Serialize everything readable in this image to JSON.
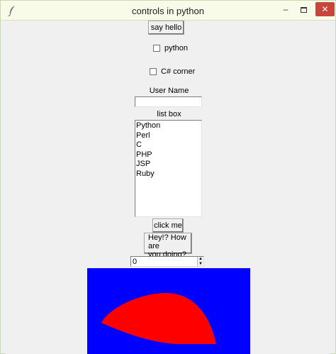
{
  "window": {
    "title": "controls in python",
    "min_label": "–",
    "close_label": "✕",
    "icon": "feather-icon"
  },
  "controls": {
    "say_hello_label": "say hello",
    "python_check_label": "python",
    "csharp_check_label": "C# corner",
    "user_name_label": "User Name",
    "user_name_value": "",
    "list_box_label": "list box",
    "list_items": [
      "Python",
      "Perl",
      "C",
      "PHP",
      "JSP",
      "Ruby"
    ],
    "click_me_label": "click me",
    "message_line1": "Hey!? How are",
    "message_line2": "you doing?",
    "spin_value": "0",
    "spin_up_glyph": "▲",
    "spin_down_glyph": "▼"
  },
  "canvas": {
    "background": "#0000ff",
    "arc_fill": "#ff0000"
  }
}
